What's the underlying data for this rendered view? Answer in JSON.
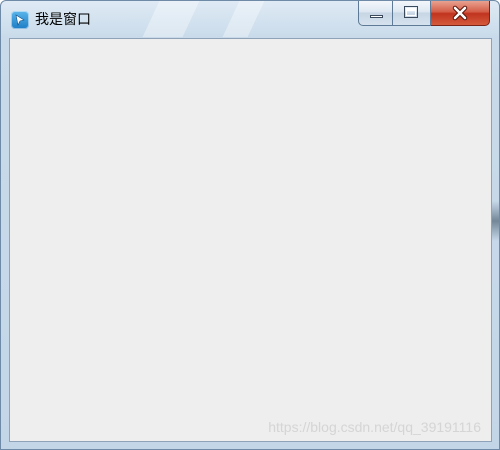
{
  "window": {
    "title": "我是窗口",
    "accent_color": "#c3d6e8",
    "client_background": "#eeeeee",
    "icons": {
      "app": "app-cursor-icon",
      "minimize": "minimize-icon",
      "maximize": "maximize-icon",
      "close": "close-icon"
    }
  },
  "watermark": {
    "text": "https://blog.csdn.net/qq_39191116"
  }
}
